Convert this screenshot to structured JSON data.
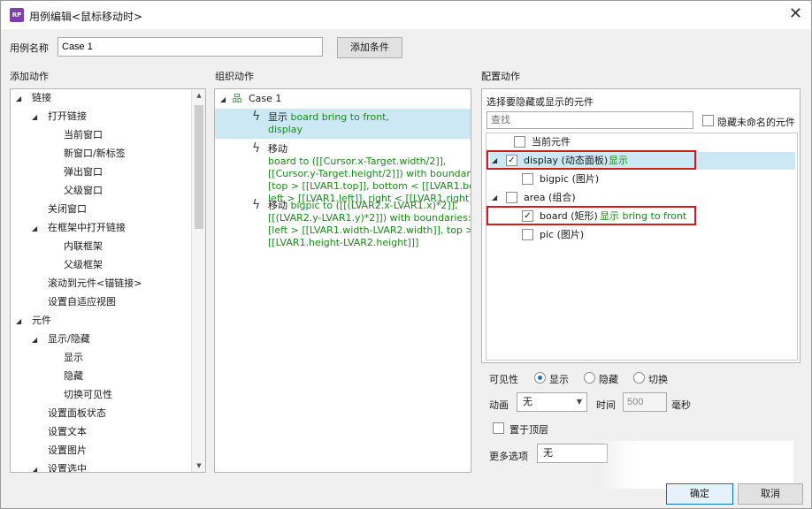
{
  "window": {
    "title": "用例编辑<鼠标移动时>",
    "app_icon_text": "RP",
    "close_glyph": "✕"
  },
  "case_name": {
    "label": "用例名称",
    "value": "Case 1",
    "add_condition_button": "添加条件"
  },
  "sections": {
    "add_action": "添加动作",
    "organize_action": "组织动作",
    "configure_action": "配置动作"
  },
  "add_action_tree": [
    {
      "label": "链接",
      "expander": "◢",
      "level": 0
    },
    {
      "label": "打开链接",
      "expander": "◢",
      "level": 1
    },
    {
      "label": "当前窗口",
      "expander": "",
      "level": 2
    },
    {
      "label": "新窗口/新标签",
      "expander": "",
      "level": 2
    },
    {
      "label": "弹出窗口",
      "expander": "",
      "level": 2
    },
    {
      "label": "父级窗口",
      "expander": "",
      "level": 2
    },
    {
      "label": "关闭窗口",
      "expander": "",
      "level": 1
    },
    {
      "label": "在框架中打开链接",
      "expander": "◢",
      "level": 1
    },
    {
      "label": "内联框架",
      "expander": "",
      "level": 2
    },
    {
      "label": "父级框架",
      "expander": "",
      "level": 2
    },
    {
      "label": "滚动到元件<锚链接>",
      "expander": "",
      "level": 1
    },
    {
      "label": "设置自适应视图",
      "expander": "",
      "level": 1
    },
    {
      "label": "元件",
      "expander": "◢",
      "level": 0
    },
    {
      "label": "显示/隐藏",
      "expander": "◢",
      "level": 1
    },
    {
      "label": "显示",
      "expander": "",
      "level": 2
    },
    {
      "label": "隐藏",
      "expander": "",
      "level": 2
    },
    {
      "label": "切换可见性",
      "expander": "",
      "level": 2
    },
    {
      "label": "设置面板状态",
      "expander": "",
      "level": 1
    },
    {
      "label": "设置文本",
      "expander": "",
      "level": 1
    },
    {
      "label": "设置图片",
      "expander": "",
      "level": 1
    },
    {
      "label": "设置选中",
      "expander": "◢",
      "level": 1
    }
  ],
  "organize": {
    "case_label": "Case 1",
    "case_expander": "◢",
    "actions": [
      {
        "verb": "显示",
        "text": "board bring to front,\ndisplay",
        "selected": true
      },
      {
        "verb": "移动",
        "text": "board to ([[Cursor.x-Target.width/2]],\n[[Cursor.y-Target.height/2]]) with boundaries:\n[top > [[LVAR1.top]], bottom < [[LVAR1.bottom]],\nleft > [[LVAR1.left]], right < [[LVAR1.right]]]",
        "selected": false
      },
      {
        "verb": "移动",
        "text": "bigpic to ([[(LVAR2.x-LVAR1.x)*2]],\n[[(LVAR2.y-LVAR1.y)*2]]) with boundaries:\n[left > [[LVAR1.width-LVAR2.width]], top >\n[[LVAR1.height-LVAR2.height]]]",
        "selected": false
      }
    ]
  },
  "configure": {
    "select_label": "选择要隐藏或显示的元件",
    "search_placeholder": "查找",
    "hide_unnamed_label": "隐藏未命名的元件",
    "widgets": [
      {
        "name": "当前元件",
        "status": "",
        "checked": false,
        "expander": "",
        "indent": 1
      },
      {
        "name": "display (动态面板)",
        "status": "显示",
        "checked": true,
        "expander": "◢",
        "indent": 0
      },
      {
        "name": "bigpic (图片)",
        "status": "",
        "checked": false,
        "expander": "",
        "indent": 2
      },
      {
        "name": "area (组合)",
        "status": "",
        "checked": false,
        "expander": "◢",
        "indent": 0
      },
      {
        "name": "board (矩形)",
        "status": "显示 bring to front",
        "checked": true,
        "expander": "",
        "indent": 2
      },
      {
        "name": "pic (图片)",
        "status": "",
        "checked": false,
        "expander": "",
        "indent": 2
      }
    ],
    "visibility_label": "可见性",
    "visibility_options": [
      "显示",
      "隐藏",
      "切换"
    ],
    "visibility_selected": "显示",
    "animation_label": "动画",
    "animation_value": "无",
    "time_label": "时间",
    "time_value": "500",
    "ms_label": "毫秒",
    "bring_front_label": "置于顶层",
    "more_options_label": "更多选项",
    "more_options_value": "无"
  },
  "footer": {
    "ok": "确定",
    "cancel": "取消"
  },
  "colors": {
    "status_green": "#1a8a1a",
    "highlight_red": "#d11c1c",
    "selection_blue": "#cce8f4"
  }
}
